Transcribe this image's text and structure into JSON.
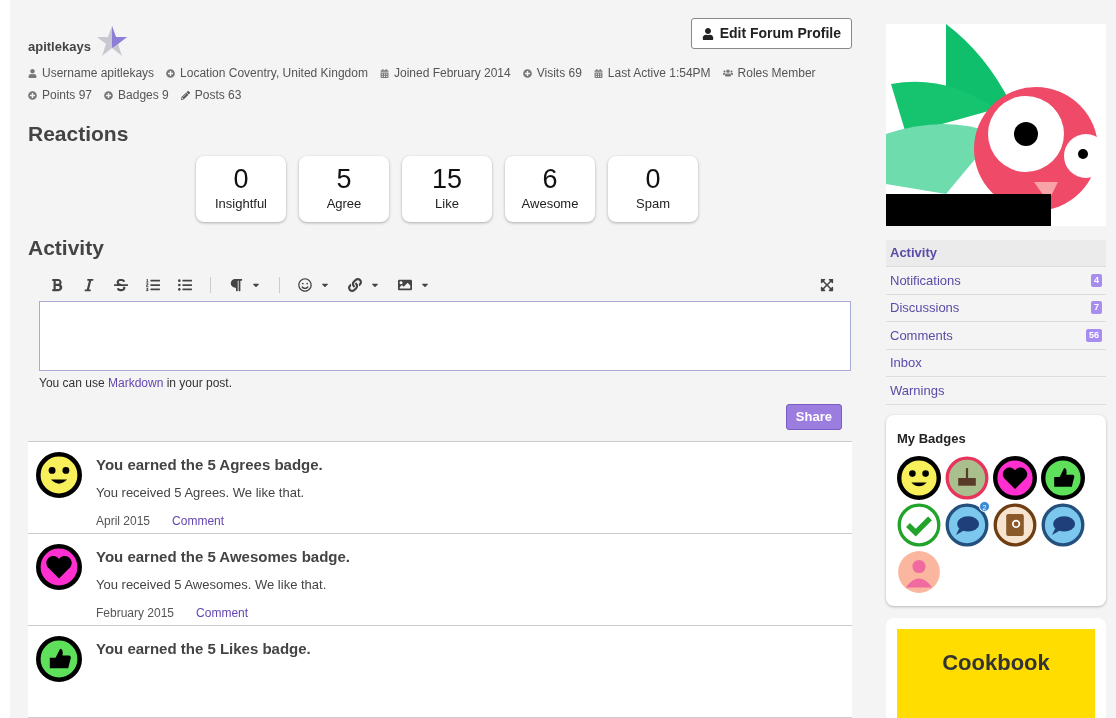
{
  "profile": {
    "name": "apitlekays",
    "edit_button": "Edit Forum Profile",
    "meta": [
      {
        "kind": "user",
        "text": "Username apitlekays"
      },
      {
        "kind": "plus",
        "text": "Location Coventry, United Kingdom"
      },
      {
        "kind": "calendar",
        "text": "Joined February 2014"
      },
      {
        "kind": "plus",
        "text": "Visits 69"
      },
      {
        "kind": "calendar",
        "text": "Last Active 1:54PM"
      },
      {
        "kind": "users",
        "text": "Roles Member"
      },
      {
        "kind": "plus",
        "text": "Points 97"
      },
      {
        "kind": "plus",
        "text": "Badges 9"
      },
      {
        "kind": "pencil",
        "text": "Posts 63"
      }
    ]
  },
  "reactions": {
    "title": "Reactions",
    "items": [
      {
        "count": "0",
        "label": "Insightful"
      },
      {
        "count": "5",
        "label": "Agree"
      },
      {
        "count": "15",
        "label": "Like"
      },
      {
        "count": "6",
        "label": "Awesome"
      },
      {
        "count": "0",
        "label": "Spam"
      }
    ]
  },
  "activity": {
    "title": "Activity",
    "hint_before": "You can use",
    "hint_link": "Markdown",
    "hint_after": "in your post.",
    "share_button": "Share",
    "items": [
      {
        "kind": "smiley",
        "title": "You earned the 5 Agrees badge.",
        "body": "You received 5 Agrees. We like that.",
        "date": "April 2015",
        "action": "Comment"
      },
      {
        "kind": "heart",
        "title": "You earned the 5 Awesomes badge.",
        "body": "You received 5 Awesomes. We like that.",
        "date": "February 2015",
        "action": "Comment"
      },
      {
        "kind": "thumb",
        "title": "You earned the 5 Likes badge."
      }
    ]
  },
  "sidebar": {
    "nav": [
      {
        "label": "Activity",
        "selected": true
      },
      {
        "label": "Notifications",
        "count": "4",
        "selected": false
      },
      {
        "label": "Discussions",
        "count": "7",
        "selected": false
      },
      {
        "label": "Comments",
        "count": "56",
        "selected": false
      },
      {
        "label": "Inbox",
        "selected": false
      },
      {
        "label": "Warnings",
        "selected": false
      }
    ],
    "badges_title": "My Badges",
    "badges": [
      {
        "kind": "smiley"
      },
      {
        "kind": "cake"
      },
      {
        "kind": "heart"
      },
      {
        "kind": "thumb"
      },
      {
        "kind": "check"
      },
      {
        "kind": "chat",
        "count": "2"
      },
      {
        "kind": "address"
      },
      {
        "kind": "chat"
      },
      {
        "kind": "person"
      }
    ],
    "promo": "Cookbook"
  }
}
